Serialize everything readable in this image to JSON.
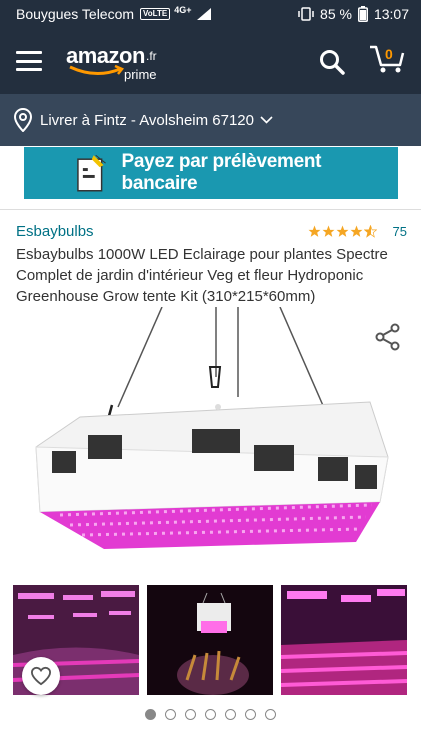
{
  "status_bar": {
    "carrier": "Bouygues Telecom",
    "volte": "VoLTE",
    "network": "4G+",
    "battery": "85 %",
    "time": "13:07"
  },
  "header": {
    "logo_text": "amazon",
    "logo_tld": ".fr",
    "logo_sub": "prime",
    "cart_count": "0"
  },
  "delivery": {
    "label": "Livrer à Fintz - Avolsheim 67120"
  },
  "banner": {
    "text": "Payez par prélèvement bancaire"
  },
  "product": {
    "brand": "Esbaybulbs",
    "rating": 4.5,
    "rating_count": "75",
    "title": "Esbaybulbs 1000W LED Eclairage pour plantes Spectre Complet de jardin d'intérieur Veg et fleur Hydroponic Greenhouse Grow tente Kit (310*215*60mm)"
  },
  "carousel": {
    "total": 7,
    "active_index": 0
  },
  "colors": {
    "header_bg": "#232f3e",
    "delivery_bg": "#37475a",
    "banner_bg": "#1a98b0",
    "link": "#007185",
    "star": "#f5a623",
    "led": "#e23bd2"
  }
}
